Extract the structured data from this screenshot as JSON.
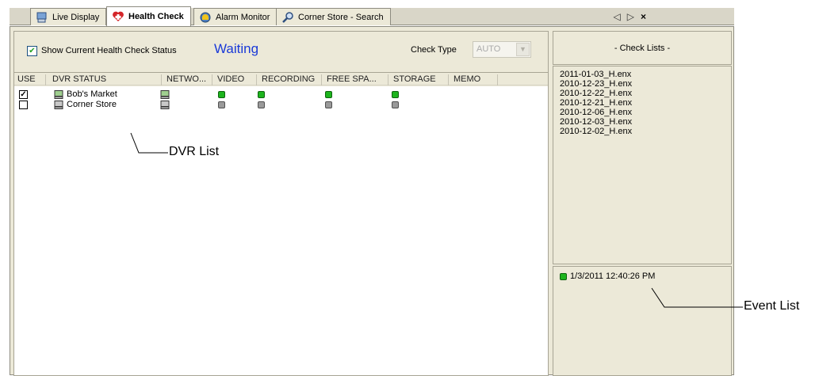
{
  "tabs": [
    {
      "label": "Live Display",
      "icon": "live-display-icon",
      "active": false
    },
    {
      "label": "Health Check",
      "icon": "health-check-icon",
      "active": true
    },
    {
      "label": "Alarm Monitor",
      "icon": "alarm-monitor-icon",
      "active": false
    },
    {
      "label": "Corner Store - Search",
      "icon": "search-icon",
      "active": false
    }
  ],
  "tab_nav": {
    "prev": "◁",
    "next": "▷",
    "close": "×"
  },
  "toolbar": {
    "show_status_label": "Show Current Health Check Status",
    "show_status_checked": true,
    "status_value": "Waiting",
    "check_type_label": "Check Type",
    "check_type_value": "AUTO"
  },
  "dvr_list": {
    "columns": [
      "USE",
      "DVR STATUS",
      "NETWO...",
      "VIDEO",
      "RECORDING",
      "FREE SPA...",
      "STORAGE",
      "MEMO"
    ],
    "rows": [
      {
        "use": true,
        "name": "Bob's Market",
        "video": "green",
        "recording": "green",
        "free_space": "green",
        "storage": "green"
      },
      {
        "use": false,
        "name": "Corner Store",
        "video": "gray",
        "recording": "gray",
        "free_space": "gray",
        "storage": "gray"
      }
    ]
  },
  "check_lists": {
    "header": "- Check Lists -",
    "items": [
      "2011-01-03_H.enx",
      "2010-12-23_H.enx",
      "2010-12-22_H.enx",
      "2010-12-21_H.enx",
      "2010-12-06_H.enx",
      "2010-12-03_H.enx",
      "2010-12-02_H.enx"
    ]
  },
  "event_list": {
    "items": [
      {
        "status": "green",
        "text": "1/3/2011 12:40:26 PM"
      }
    ]
  },
  "annotations": {
    "dvr_list": "DVR List",
    "event_list": "Event List"
  },
  "colors": {
    "status_value": "#1a3ad8",
    "led_green": "#1db41d",
    "led_gray": "#9a9a9a",
    "panel_bg": "#ece9d8"
  }
}
